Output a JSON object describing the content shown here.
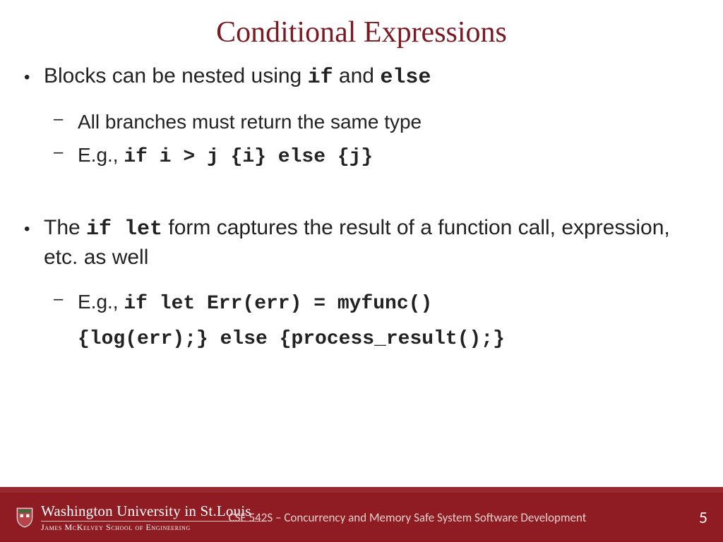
{
  "title": "Conditional Expressions",
  "bullets": {
    "b1a_pre": "Blocks can be nested using ",
    "b1a_c1": "if",
    "b1a_mid": " and ",
    "b1a_c2": "else",
    "b1a_s1": "All branches must return the same type",
    "b1a_s2_pre": "E.g., ",
    "b1a_s2_code": "if i > j {i} else {j}",
    "b1b_pre": "The ",
    "b1b_c1": "if let",
    "b1b_post": " form captures the result of a function call, expression, etc. as well",
    "b1b_s1_pre": "E.g., ",
    "b1b_s1_code1": "if let Err(err) = myfunc()",
    "b1b_s1_code2": "{log(err);} else {process_result();}"
  },
  "footer": {
    "university": "Washington University in St.Louis",
    "school": "James McKelvey School of Engineering",
    "course": "CSE 542S – Concurrency and Memory Safe System Software Development",
    "page": "5"
  }
}
